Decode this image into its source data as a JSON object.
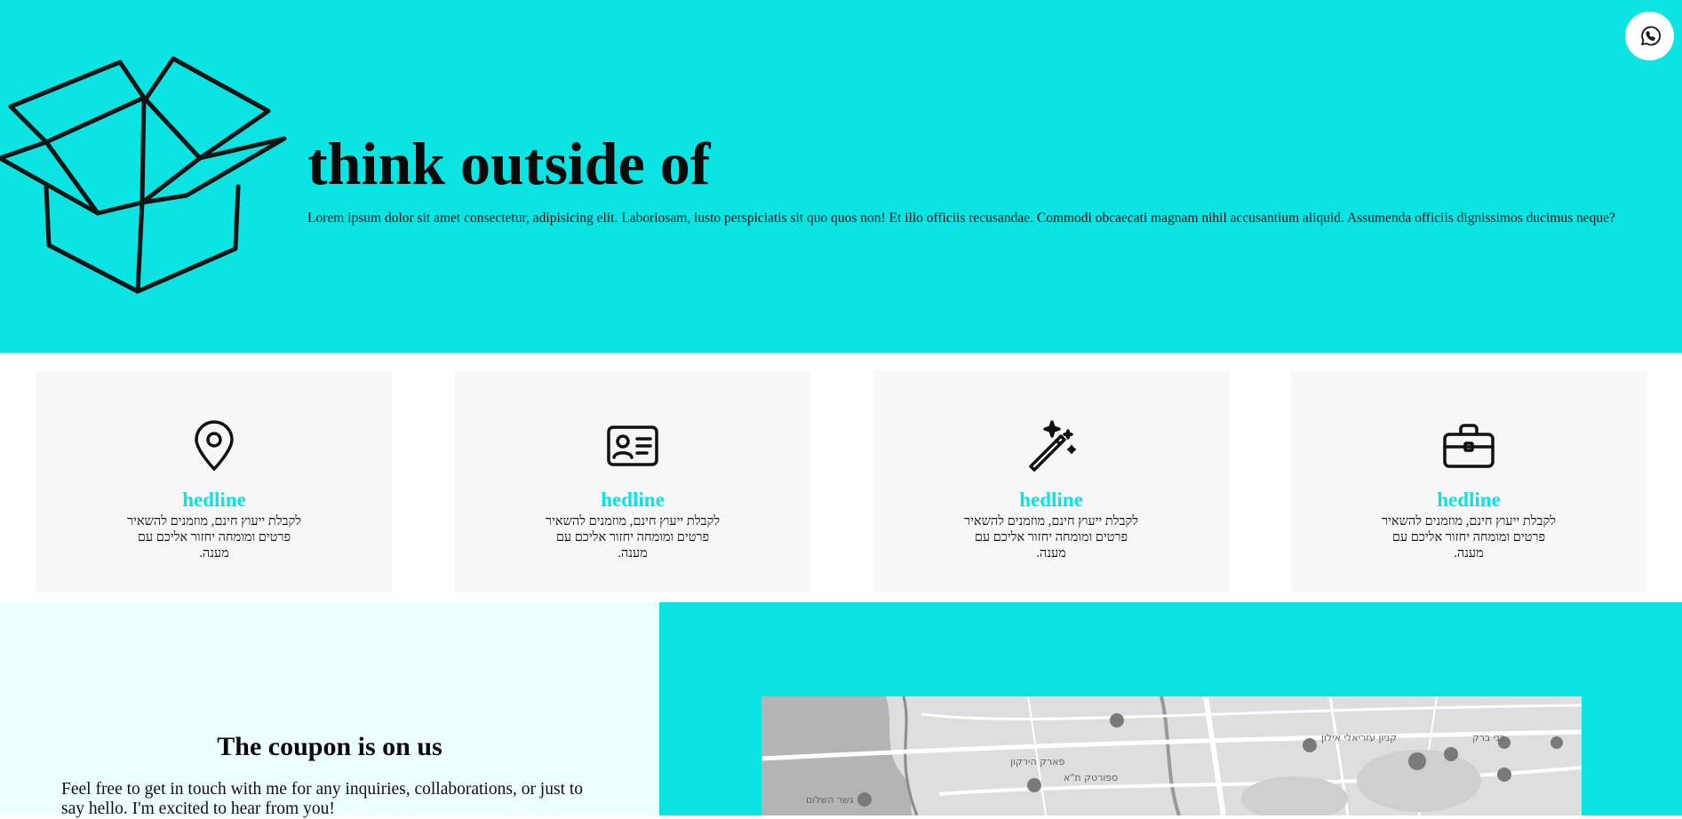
{
  "hero": {
    "title": "think outside of",
    "body": "Lorem ipsum dolor sit amet consectetur, adipisicing elit. Laboriosam, iusto perspiciatis sit quo quos non! Et illo officiis recusandae. Commodi obcaecati magnam nihil accusantium aliquid. Assumenda officiis dignissimos ducimus neque?",
    "illustration": "open-box-icon",
    "whatsapp_icon": "whatsapp-icon"
  },
  "features": [
    {
      "icon": "map-pin-icon",
      "title": "hedline",
      "text": "לקבלת ייעוץ חינם, מוזמנים להשאיר פרטים ומומחה יחזור אליכם עם מענה."
    },
    {
      "icon": "id-card-icon",
      "title": "hedline",
      "text": "לקבלת ייעוץ חינם, מוזמנים להשאיר פרטים ומומחה יחזור אליכם עם מענה."
    },
    {
      "icon": "magic-wand-icon",
      "title": "hedline",
      "text": "לקבלת ייעוץ חינם, מוזמנים להשאיר פרטים ומומחה יחזור אליכם עם מענה."
    },
    {
      "icon": "briefcase-icon",
      "title": "hedline",
      "text": "לקבלת ייעוץ חינם, מוזמנים להשאיר פרטים ומומחה יחזור אליכם עם מענה."
    }
  ],
  "contact": {
    "title": "The coupon is on us",
    "body": "Feel free to get in touch with me for any inquiries, collaborations, or just to say hello. I'm excited to hear from you!"
  },
  "map": {
    "labels": [
      "גשר השלום",
      "פארק הירקון",
      "ספורטק ת\"א",
      "בני ברק",
      "קניון עזריאלי אילון"
    ]
  },
  "colors": {
    "accent": "#0ce3e3",
    "light_accent": "#edfefe",
    "card_bg": "#f7f7f7"
  }
}
